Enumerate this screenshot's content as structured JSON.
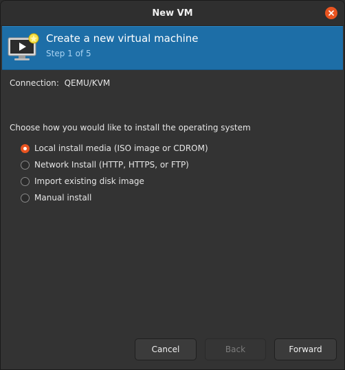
{
  "window": {
    "title": "New VM"
  },
  "banner": {
    "title": "Create a new virtual machine",
    "step": "Step 1 of 5",
    "icon": "vm-monitor-icon"
  },
  "connection": {
    "text": "Connection:  QEMU/KVM"
  },
  "install": {
    "prompt": "Choose how you would like to install the operating system",
    "selected": 0,
    "options": [
      {
        "label": "Local install media (ISO image or CDROM)",
        "checked": true
      },
      {
        "label": "Network Install (HTTP, HTTPS, or FTP)",
        "checked": false
      },
      {
        "label": "Import existing disk image",
        "checked": false
      },
      {
        "label": "Manual install",
        "checked": false
      }
    ]
  },
  "buttons": {
    "cancel": "Cancel",
    "back": "Back",
    "forward": "Forward"
  },
  "colors": {
    "accent": "#e95420",
    "banner": "#1d6ea7",
    "background": "#333333"
  }
}
